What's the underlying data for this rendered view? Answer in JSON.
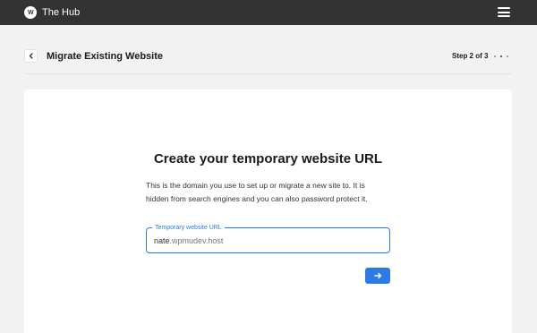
{
  "app": {
    "title": "The Hub",
    "logo_text": "W"
  },
  "header": {
    "title": "Migrate Existing Website",
    "step": "Step 2 of 3",
    "steps_total": 3,
    "current_step": 2
  },
  "main": {
    "heading": "Create your temporary website URL",
    "description_lines": [
      "This is the domain you use to set up or migrate a new site to. It is",
      "hidden from search engines and you can also password protect it."
    ],
    "field": {
      "label": "Temporary website URL",
      "value_prefix": "nate",
      "value_suffix": ".wpmudev.host"
    }
  },
  "icons": {
    "menu": "hamburger-menu-icon",
    "back": "chevron-left-icon",
    "next": "arrow-right-icon"
  },
  "colors": {
    "topbar": "#333333",
    "accent": "#2c7be5",
    "background": "#f2f2f2",
    "card": "#ffffff"
  }
}
